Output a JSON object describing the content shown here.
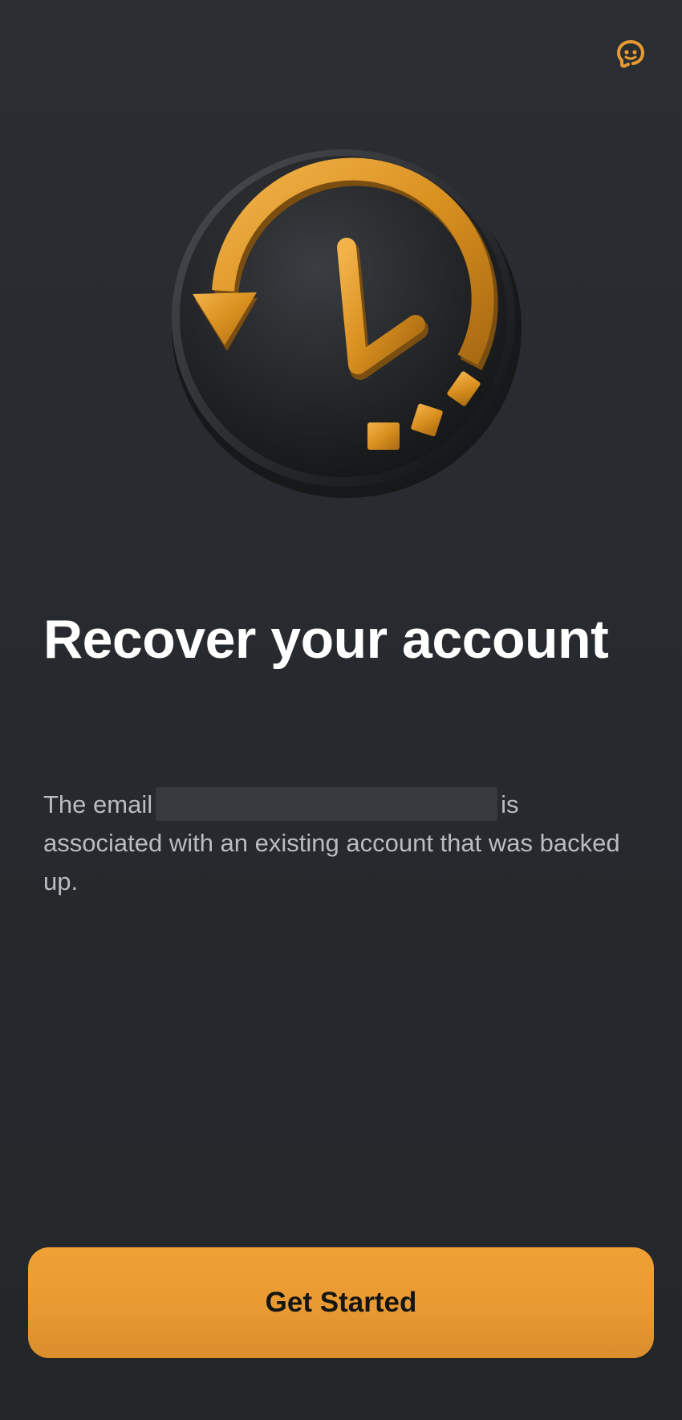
{
  "header": {
    "support_icon": "support-agent-icon"
  },
  "hero": {
    "icon": "clock-restore-icon"
  },
  "content": {
    "title": "Recover your account",
    "description_prefix": "The email",
    "description_suffix": "is associated with an existing account that was backed up."
  },
  "actions": {
    "primary_label": "Get Started"
  },
  "colors": {
    "background": "#272b2f",
    "accent": "#e89a32",
    "text_primary": "#ffffff",
    "text_secondary": "#b9bcc0"
  }
}
